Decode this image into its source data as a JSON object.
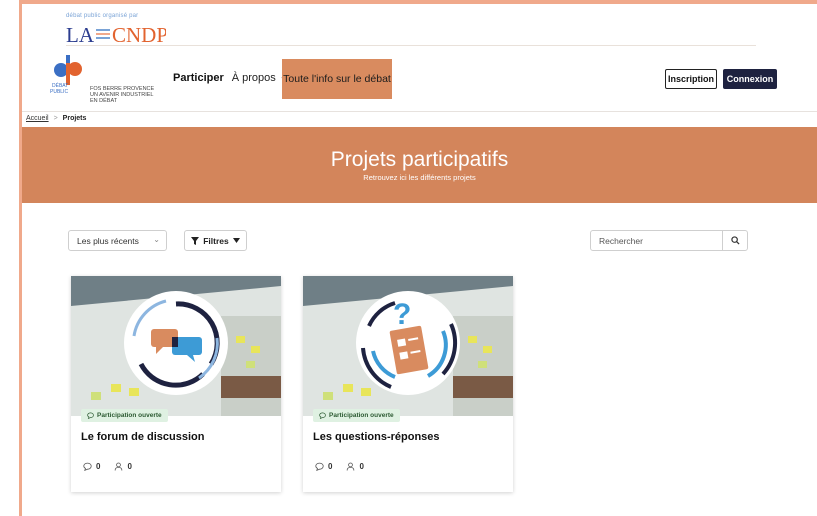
{
  "organizer": {
    "caption": "débat public organisé par",
    "logo_text": "LA CNDP"
  },
  "header": {
    "logo_text": "dp",
    "logo_small": "DÉBAT PUBLIC",
    "project_lines": [
      "FOS BERRE PROVENCE",
      "UN AVENIR INDUSTRIEL",
      "EN DÉBAT"
    ],
    "nav": {
      "participer": "Participer",
      "apropos": "À propos",
      "info": "Toute l'info sur le débat"
    },
    "inscription": "Inscription",
    "connexion": "Connexion"
  },
  "breadcrumb": {
    "home": "Accueil",
    "separator": ">",
    "current": "Projets"
  },
  "hero": {
    "title": "Projets participatifs",
    "subtitle": "Retrouvez ici les différents projets"
  },
  "toolbar": {
    "sort_selected": "Les plus récents",
    "filter_label": "Filtres",
    "search_placeholder": "Rechercher"
  },
  "cards": [
    {
      "badge": "Participation ouverte",
      "title": "Le forum de discussion",
      "comments": "0",
      "participants": "0",
      "icon": "chat-bubbles-icon"
    },
    {
      "badge": "Participation ouverte",
      "title": "Les questions-réponses",
      "comments": "0",
      "participants": "0",
      "icon": "question-form-icon"
    }
  ],
  "colors": {
    "accent": "#d3855b",
    "nav_highlight": "#d98b5f",
    "dark_button": "#1e2240",
    "badge_bg": "#dff1e2"
  }
}
